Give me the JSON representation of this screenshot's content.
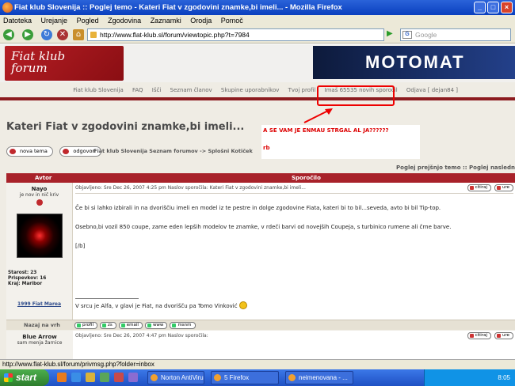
{
  "window": {
    "title": "Fiat klub Slovenija :: Poglej temo - Kateri Fiat v zgodovini znamke,bi imeli... - Mozilla Firefox"
  },
  "menu": [
    "Datoteka",
    "Urejanje",
    "Pogled",
    "Zgodovina",
    "Zaznamki",
    "Orodja",
    "Pomoč"
  ],
  "address": {
    "url": "http://www.flat-klub.sl/forum/viewtopic.php?t=7984",
    "search_placeholder": "Google"
  },
  "site": {
    "logo_line1": "Fiat klub",
    "logo_line2": "forum",
    "banner_ad": "MOTOMAT",
    "nav": [
      "Fiat klub Slovenija",
      "FAQ",
      "Išči",
      "Seznam članov",
      "Skupine uporabnikov",
      "Tvoj profil",
      "Imaš 65535 novih sporočil",
      "Odjava [ dejan84 ]"
    ]
  },
  "topic": {
    "title": "Kateri Fiat v zgodovini znamke,bi imeli...",
    "new_topic": "nova tema",
    "reply": "odgovori",
    "breadcrumb": "Fiat klub Slovenija Seznam forumov -> Splošni Kotiček",
    "prev_next": "Poglej prejšnjo temo :: Poglej nasledn"
  },
  "popup": {
    "line1": "A SE VAM JE ENMAU STRGAL AL JA??????",
    "line2": "rb"
  },
  "table": {
    "col_author": "Avtor",
    "col_message": "Sporočilo"
  },
  "post": {
    "author": "Nayo",
    "rank": "je nov in nič kriv",
    "stats": [
      "Starost: 23",
      "Prispevkov: 16",
      "Kraj: Maribor"
    ],
    "car": "1999 Fiat Marea",
    "meta": "Objavljeno: Sre Dec 26, 2007 4:25 pm    Naslov sporočila: Kateri Fiat v zgodovini znamke,bi imeli...",
    "btn_quote": "citiraj",
    "btn_edit": "ure",
    "body": [
      "Če bi si lahko izbirali in na dvoriščiu imeli en model iz te pestre in dolge zgodovine Fiata, kateri bi to bil...seveda, avto bi bil Tip-top.",
      "Osebno,bi vozil 850 coupe, zame eden lepših modelov te znamke, v rdeči barvi od novejših Coupeja, s turbinico rumene ali črne barve.",
      "[/b]"
    ],
    "signature": "V srcu je Alfa, v glavi je Fiat, na dvorišču pa Tomo Vinković"
  },
  "post_footer": {
    "back_to_top": "Nazaj na vrh",
    "buttons": [
      "profil",
      "zs",
      "email",
      "www",
      "msnm"
    ]
  },
  "next_post": {
    "author": "Blue Arrow",
    "rank": "sam menja žarnice",
    "meta": "Objavljeno: Sre Dec 26, 2007 4:47 pm    Naslov sporočila:",
    "btn_quote": "citiraj",
    "btn_edit": "ure"
  },
  "statusbar": {
    "text": "http://www.flat-klub.sl/forum/privmsg.php?folder=inbox"
  },
  "taskbar": {
    "start": "start",
    "tasks": [
      "Norton AntiVirus",
      "5 Firefox",
      "neimenovana - ..."
    ],
    "clock": "8:05"
  }
}
